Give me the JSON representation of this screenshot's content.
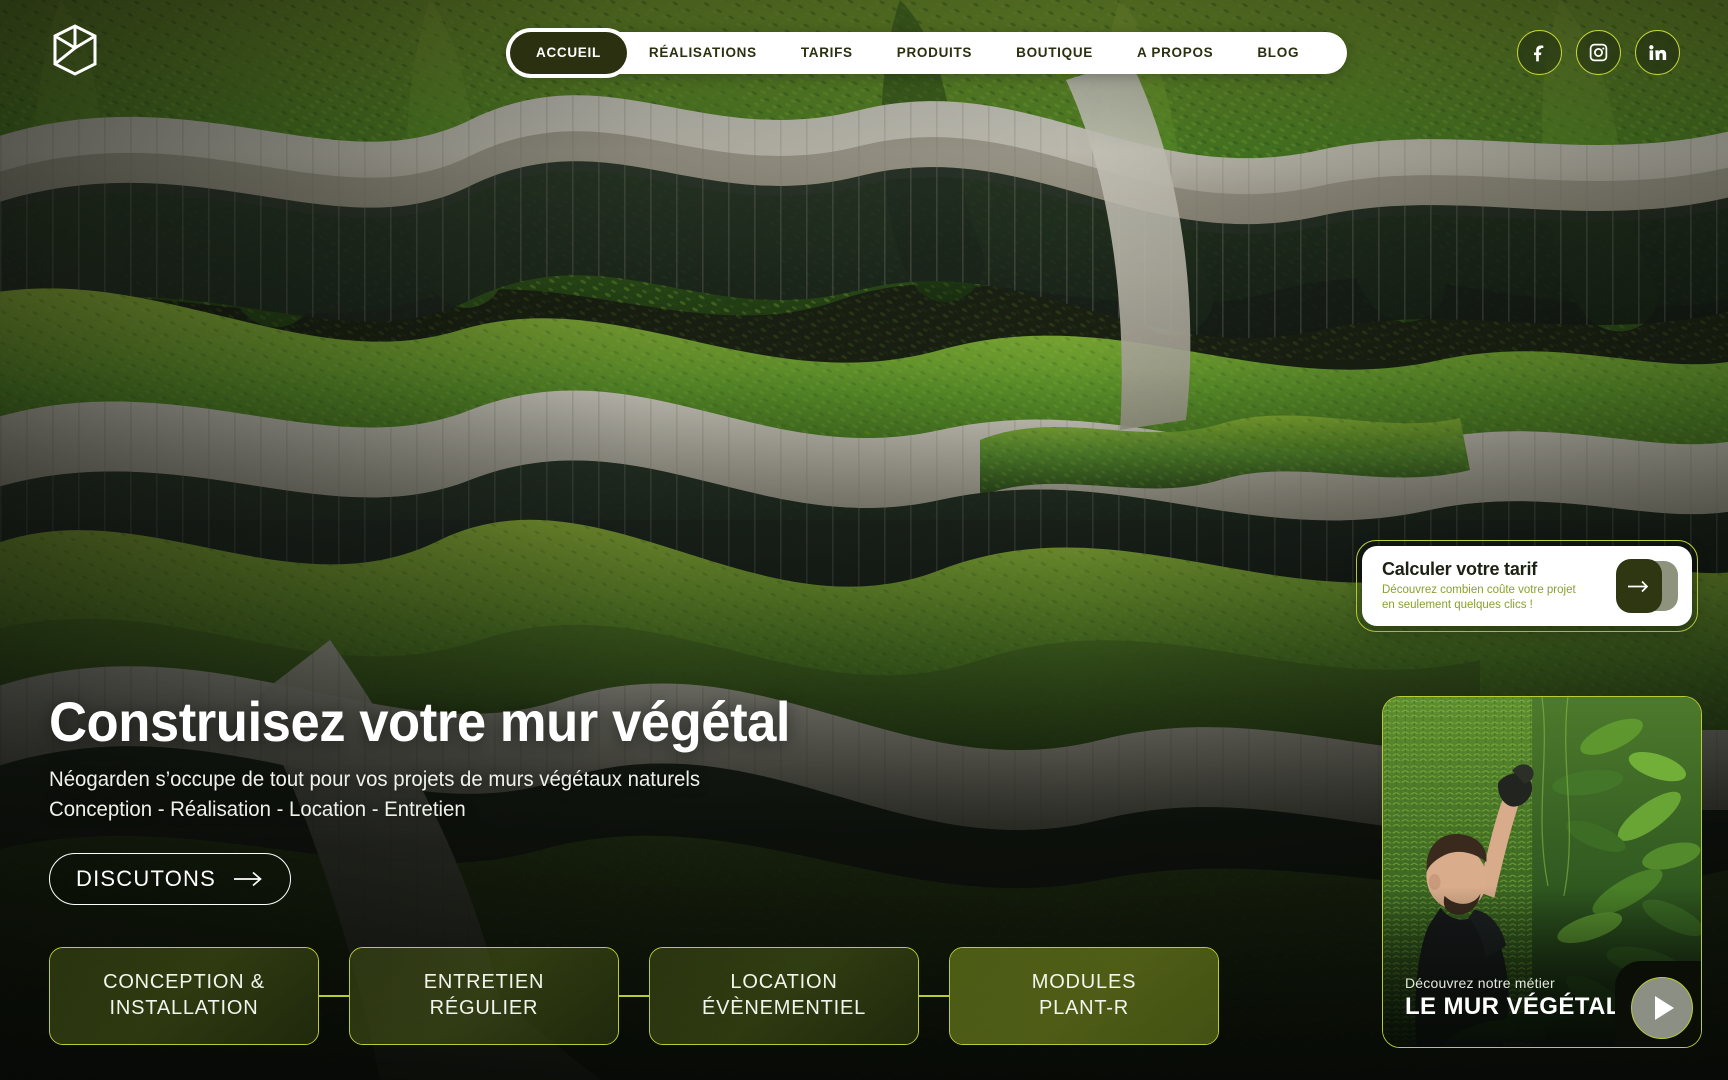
{
  "brand": {
    "logo_icon": "cube-logo-icon",
    "name": "Néogarden"
  },
  "nav": {
    "items": [
      {
        "label": "ACCUEIL",
        "active": true
      },
      {
        "label": "RÉALISATIONS",
        "active": false
      },
      {
        "label": "TARIFS",
        "active": false
      },
      {
        "label": "PRODUITS",
        "active": false
      },
      {
        "label": "BOUTIQUE",
        "active": false
      },
      {
        "label": "A PROPOS",
        "active": false
      },
      {
        "label": "BLOG",
        "active": false
      }
    ]
  },
  "socials": [
    {
      "name": "facebook-icon",
      "label": "Facebook"
    },
    {
      "name": "instagram-icon",
      "label": "Instagram"
    },
    {
      "name": "linkedin-icon",
      "label": "LinkedIn"
    }
  ],
  "hero": {
    "title": "Construisez votre mur végétal",
    "subtitle_line1": "Néogarden s’occupe de tout pour vos projets de murs végétaux naturels",
    "subtitle_line2": "Conception - Réalisation - Location - Entretien",
    "cta_label": "DISCUTONS",
    "cta_icon": "arrow-right-icon"
  },
  "services": [
    {
      "line1": "CONCEPTION &",
      "line2": "INSTALLATION",
      "bright": false
    },
    {
      "line1": "ENTRETIEN",
      "line2": "RÉGULIER",
      "bright": false
    },
    {
      "line1": "LOCATION",
      "line2": "ÉVÈNEMENTIEL",
      "bright": false
    },
    {
      "line1": "MODULES",
      "line2": "PLANT-R",
      "bright": true
    }
  ],
  "tarif_card": {
    "title": "Calculer votre tarif",
    "desc_line1": "Découvrez combien coûte votre projet",
    "desc_line2": "en seulement quelques clics !",
    "button_icon": "arrow-right-icon"
  },
  "video_card": {
    "kicker": "Découvrez notre métier",
    "title": "LE MUR VÉGÉTAL",
    "play_icon": "play-icon"
  },
  "colors": {
    "accent_lime": "#b9cc34",
    "dark_olive": "#2b3010",
    "white": "#ffffff",
    "desc_green": "#8aa02f"
  }
}
